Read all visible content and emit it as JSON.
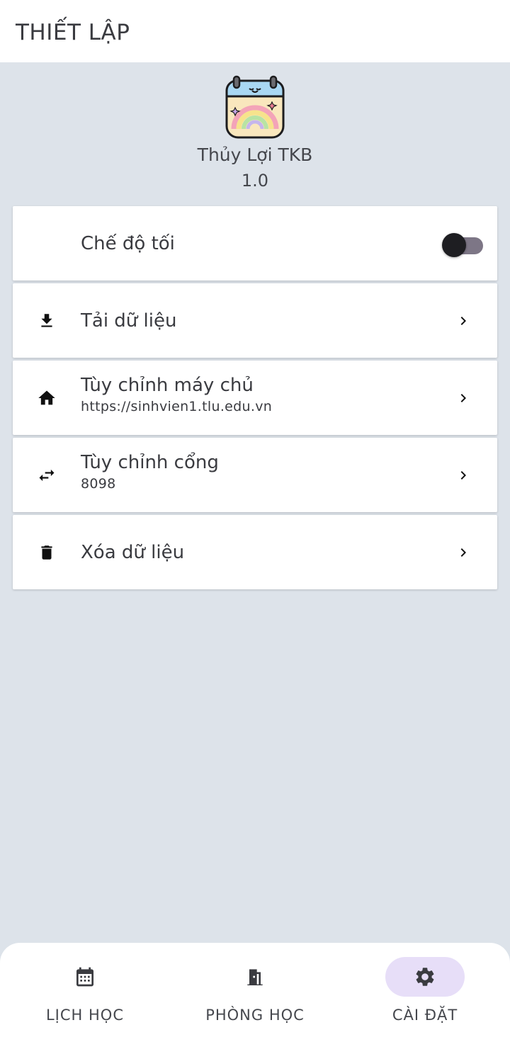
{
  "header": {
    "title": "THIẾT LẬP"
  },
  "app": {
    "name": "Thủy Lợi TKB",
    "version": "1.0",
    "logo_icon": "rainbow-calendar-logo"
  },
  "settings": {
    "dark_mode": {
      "label": "Chế độ tối",
      "icon": "moon-icon",
      "enabled": false
    },
    "download": {
      "label": "Tải dữ liệu",
      "icon": "download-icon"
    },
    "server": {
      "label": "Tùy chỉnh máy chủ",
      "value": "https://sinhvien1.tlu.edu.vn",
      "icon": "home-icon"
    },
    "port": {
      "label": "Tùy chỉnh cổng",
      "value": "8098",
      "icon": "swap-arrows-icon"
    },
    "clear": {
      "label": "Xóa dữ liệu",
      "icon": "trash-icon"
    }
  },
  "nav": {
    "items": [
      {
        "label": "LỊCH HỌC",
        "icon": "calendar-icon",
        "active": false
      },
      {
        "label": "PHÒNG HỌC",
        "icon": "door-icon",
        "active": false
      },
      {
        "label": "CÀI ĐẶT",
        "icon": "gear-icon",
        "active": true
      }
    ]
  },
  "colors": {
    "background": "#dde3ea",
    "card": "#ffffff",
    "active_pill": "#e7def8",
    "toggle_track": "#7d7686",
    "toggle_thumb": "#1e1e22"
  }
}
